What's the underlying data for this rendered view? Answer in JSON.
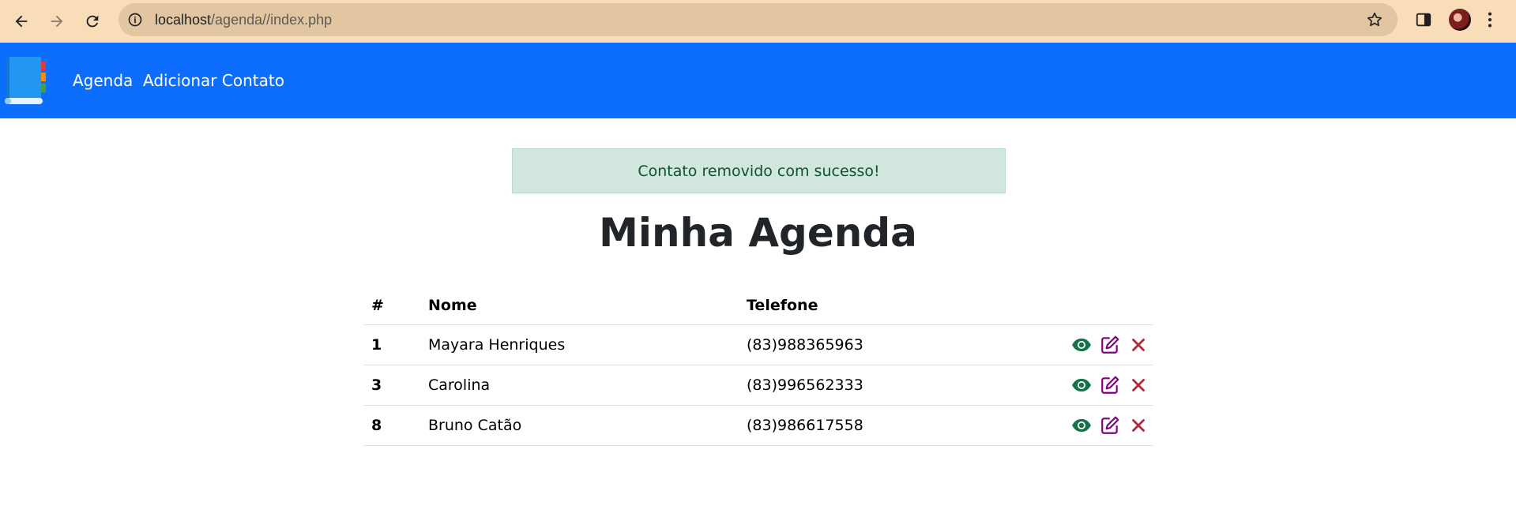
{
  "browser": {
    "url_host": "localhost",
    "url_path": "/agenda//index.php"
  },
  "navbar": {
    "logo": "address-book-logo",
    "links": [
      {
        "label": "Agenda"
      },
      {
        "label": "Adicionar Contato"
      }
    ],
    "color": "#0d6efd"
  },
  "alert": {
    "message": "Contato removido com sucesso!",
    "status_color": "#d1e7dd"
  },
  "title": "Minha Agenda",
  "table": {
    "headers": {
      "id": "#",
      "name": "Nome",
      "phone": "Telefone"
    },
    "rows": [
      {
        "id": "1",
        "name": "Mayara Henriques",
        "phone": "(83)988365963"
      },
      {
        "id": "3",
        "name": "Carolina",
        "phone": "(83)996562333"
      },
      {
        "id": "8",
        "name": "Bruno Catão",
        "phone": "(83)986617558"
      }
    ],
    "actions": [
      {
        "icon": "eye-icon",
        "color": "#157347"
      },
      {
        "icon": "edit-icon",
        "color": "#800080"
      },
      {
        "icon": "close-icon",
        "color": "#b02a37"
      }
    ]
  }
}
